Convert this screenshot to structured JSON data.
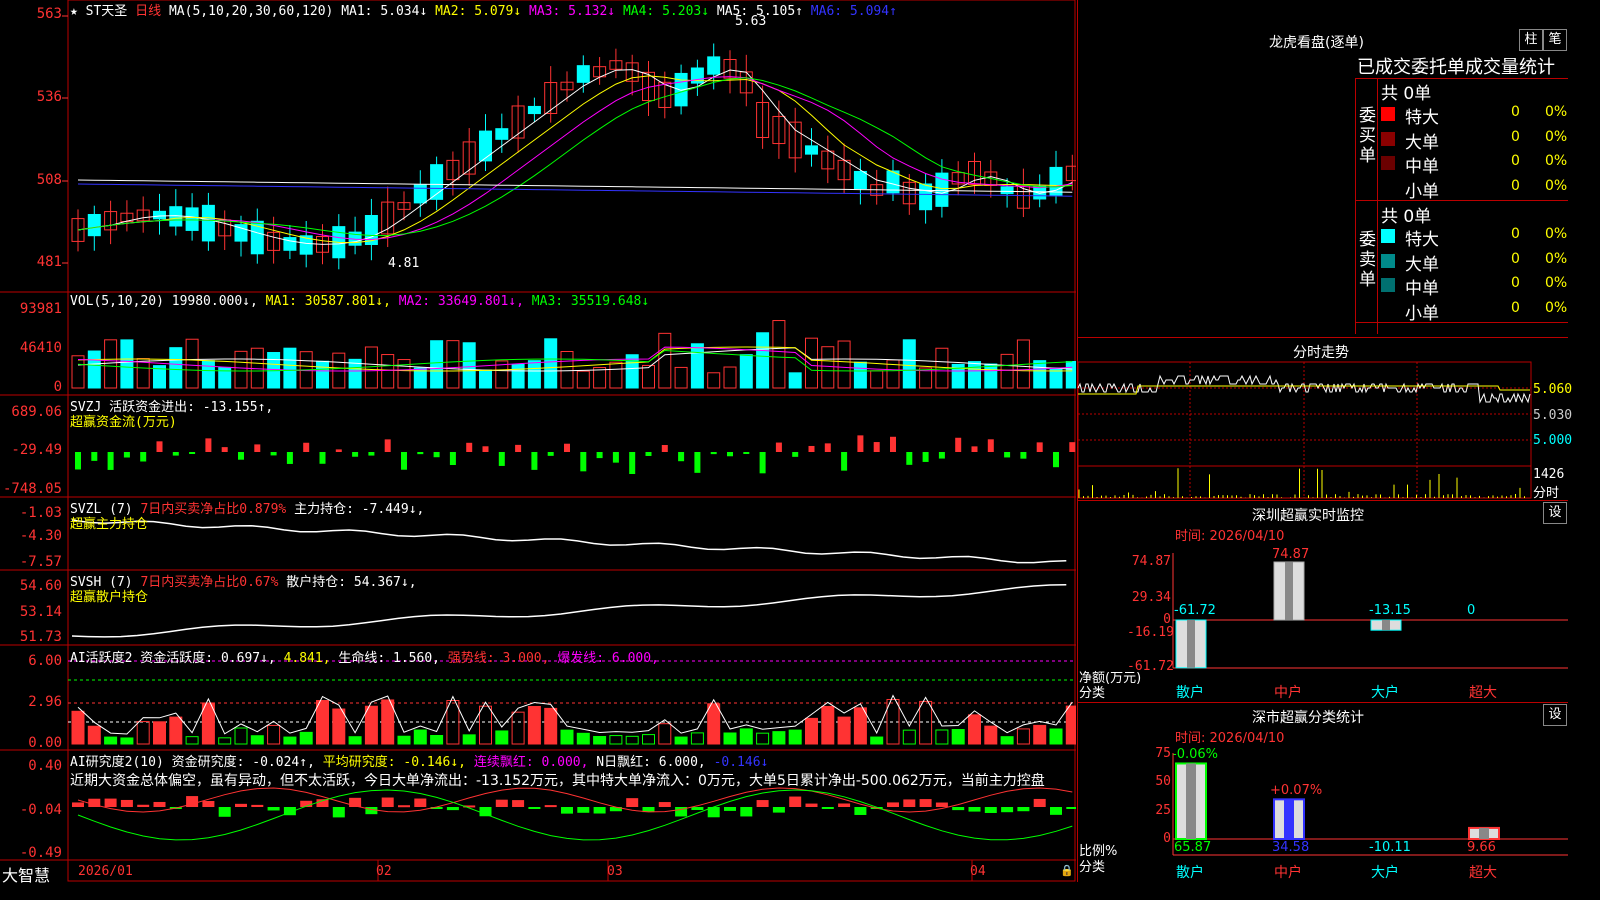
{
  "header": {
    "star": "★",
    "stock_name": "ST天圣",
    "period": "日线",
    "ma_params": "MA(5,10,20,30,60,120)",
    "ma1": "MA1: 5.034↓",
    "ma2": "MA2: 5.079↓",
    "ma3": "MA3: 5.132↓",
    "ma4": "MA4: 5.203↓",
    "ma5": "MA5: 5.105↑",
    "ma6": "MA6: 5.094↑"
  },
  "price_panel": {
    "y_ticks": [
      "563",
      "536",
      "508",
      "481"
    ],
    "high_label": "5.63",
    "low_label": "4.81"
  },
  "vol_panel": {
    "caption_a": "VOL(5,10,20) 19980.000↓,",
    "caption_b": "MA1: 30587.801↓,",
    "caption_c": "MA2: 33649.801↓,",
    "caption_d": "MA3: 35519.648↓",
    "y_ticks": [
      "93981",
      "46410",
      "0"
    ]
  },
  "svzj_panel": {
    "caption_a": "SVZJ  活跃资金进出: -13.155↑,",
    "caption_b": "超赢资金流(万元)",
    "y_ticks": [
      "689.06",
      "-29.49",
      "-748.05"
    ]
  },
  "svzl_panel": {
    "caption_a": "SVZL (7)",
    "caption_b": "7日内买卖净占比0.879%",
    "caption_c": "主力持仓: -7.449↓,",
    "caption_d": "超赢主力持仓",
    "y_ticks": [
      "-1.03",
      "-4.30",
      "-7.57"
    ]
  },
  "svsh_panel": {
    "caption_a": "SVSH (7)",
    "caption_b": "7日内买卖净占比0.67%",
    "caption_c": "散户持仓: 54.367↓,",
    "caption_d": "超赢散户持仓",
    "y_ticks": [
      "54.60",
      "53.14",
      "51.73"
    ]
  },
  "ai_active_panel": {
    "caption_a": "AI活跃度2 资金活跃度: 0.697↓,",
    "caption_b": "4.841,",
    "caption_c": "生命线: 1.560,",
    "caption_d": "强势线: 3.000,",
    "caption_e": "爆发线: 6.000,",
    "y_ticks": [
      "6.00",
      "2.96",
      "0.00"
    ]
  },
  "ai_research_panel": {
    "caption_a": "AI研究度2(10)",
    "caption_b": "资金研究度: -0.024↑,",
    "caption_c": "平均研究度: -0.146↓,",
    "caption_d": "连续飘红: 0.000,",
    "caption_e": "N日飘红: 6.000,",
    "caption_f": "-0.146↓",
    "commentary": "近期大资金总体偏空，虽有异动，但不太活跃，今日大单净流出：-13.152万元，其中特大单净流入：0万元，大单5日累计净出-500.062万元，当前主力控盘",
    "y_ticks": [
      "0.40",
      "-0.04",
      "-0.49"
    ]
  },
  "bottom_axis": {
    "brand": "大智慧",
    "dates": [
      "2026/01",
      "02",
      "03",
      "04"
    ]
  },
  "dragon_tiger": {
    "title": "龙虎看盘(逐单)",
    "btn_bar": "柱",
    "btn_pen": "笔",
    "subtitle": "已成交委托单成交量统计",
    "buy_side": "委买单",
    "sell_side": "委卖单",
    "buy_total": "共 0单",
    "sell_total": "共 0单",
    "buy_rows": [
      {
        "label": "特大",
        "count": "0",
        "pct": "0%",
        "color": "#ff0000"
      },
      {
        "label": "大单",
        "count": "0",
        "pct": "0%",
        "color": "#8b0000"
      },
      {
        "label": "中单",
        "count": "0",
        "pct": "0%",
        "color": "#6b0000"
      },
      {
        "label": "小单",
        "count": "0",
        "pct": "0%",
        "color": ""
      }
    ],
    "sell_rows": [
      {
        "label": "特大",
        "count": "0",
        "pct": "0%",
        "color": "#00ffff"
      },
      {
        "label": "大单",
        "count": "0",
        "pct": "0%",
        "color": "#008b8b"
      },
      {
        "label": "中单",
        "count": "0",
        "pct": "0%",
        "color": "#007070"
      },
      {
        "label": "小单",
        "count": "0",
        "pct": "0%",
        "color": ""
      }
    ]
  },
  "intraday": {
    "title": "分时走势",
    "price_ticks": [
      "5.060",
      "5.030",
      "5.000"
    ],
    "vol_tick": "1426",
    "vol_unit": "分时"
  },
  "sz_monitor": {
    "title": "深圳超赢实时监控",
    "settings_btn": "设",
    "time": "时间: 2026/04/10",
    "y_ticks": [
      "74.87",
      "29.34",
      "0",
      "-16.19",
      "-61.72"
    ],
    "axis_label_a": "净额(万元)",
    "axis_label_b": "分类",
    "categories": [
      "散户",
      "中户",
      "大户",
      "超大"
    ],
    "values": [
      -61.72,
      74.87,
      -13.15,
      0
    ],
    "value_labels": [
      "-61.72",
      "74.87",
      "-13.15",
      "0"
    ]
  },
  "sz_classify": {
    "title": "深市超赢分类统计",
    "settings_btn": "设",
    "time": "时间: 2026/04/10",
    "y_ticks": [
      "75",
      "50",
      "25",
      "0"
    ],
    "axis_label_a": "比例%",
    "axis_label_b": "分类",
    "categories": [
      "散户",
      "中户",
      "大户",
      "超大"
    ],
    "values": [
      65.87,
      34.58,
      -10.11,
      9.66
    ],
    "value_labels": [
      "65.87",
      "34.58",
      "-10.11",
      "9.66"
    ],
    "change_labels": [
      "-0.06%",
      "+0.07%",
      "",
      ""
    ]
  }
}
